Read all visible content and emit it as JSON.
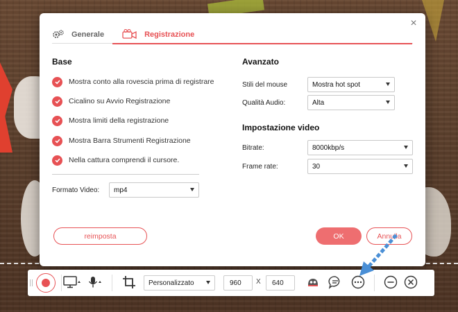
{
  "dialog": {
    "tabs": [
      {
        "label": "Generale",
        "icon": "gears-icon"
      },
      {
        "label": "Registrazione",
        "icon": "camera-icon"
      }
    ],
    "base": {
      "title": "Base",
      "options": [
        {
          "label": "Mostra conto alla rovescia prima di registrare",
          "checked": true
        },
        {
          "label": "Cicalino su Avvio Registrazione",
          "checked": true
        },
        {
          "label": "Mostra limiti della registrazione",
          "checked": true
        },
        {
          "label": "Mostra Barra Strumenti Registrazione",
          "checked": true
        },
        {
          "label": "Nella cattura comprendi il cursore.",
          "checked": true
        }
      ],
      "format_label": "Formato Video:",
      "format_value": "mp4"
    },
    "advanced": {
      "title": "Avanzato",
      "mouse_label": "Stili del mouse",
      "mouse_value": "Mostra hot spot",
      "audio_label": "Qualità Audio:",
      "audio_value": "Alta"
    },
    "video": {
      "title": "Impostazione video",
      "bitrate_label": "Bitrate:",
      "bitrate_value": "8000kbp/s",
      "framerate_label": "Frame rate:",
      "framerate_value": "30"
    },
    "buttons": {
      "reset": "reimposta",
      "ok": "OK",
      "cancel": "Annulla"
    }
  },
  "toolbar": {
    "size_preset": "Personalizzato",
    "width": "960",
    "x_separator": "X",
    "height": "640"
  },
  "colors": {
    "accent": "#e75154",
    "ok_fill": "#ee6e70",
    "arrow": "#4a8fd6"
  }
}
